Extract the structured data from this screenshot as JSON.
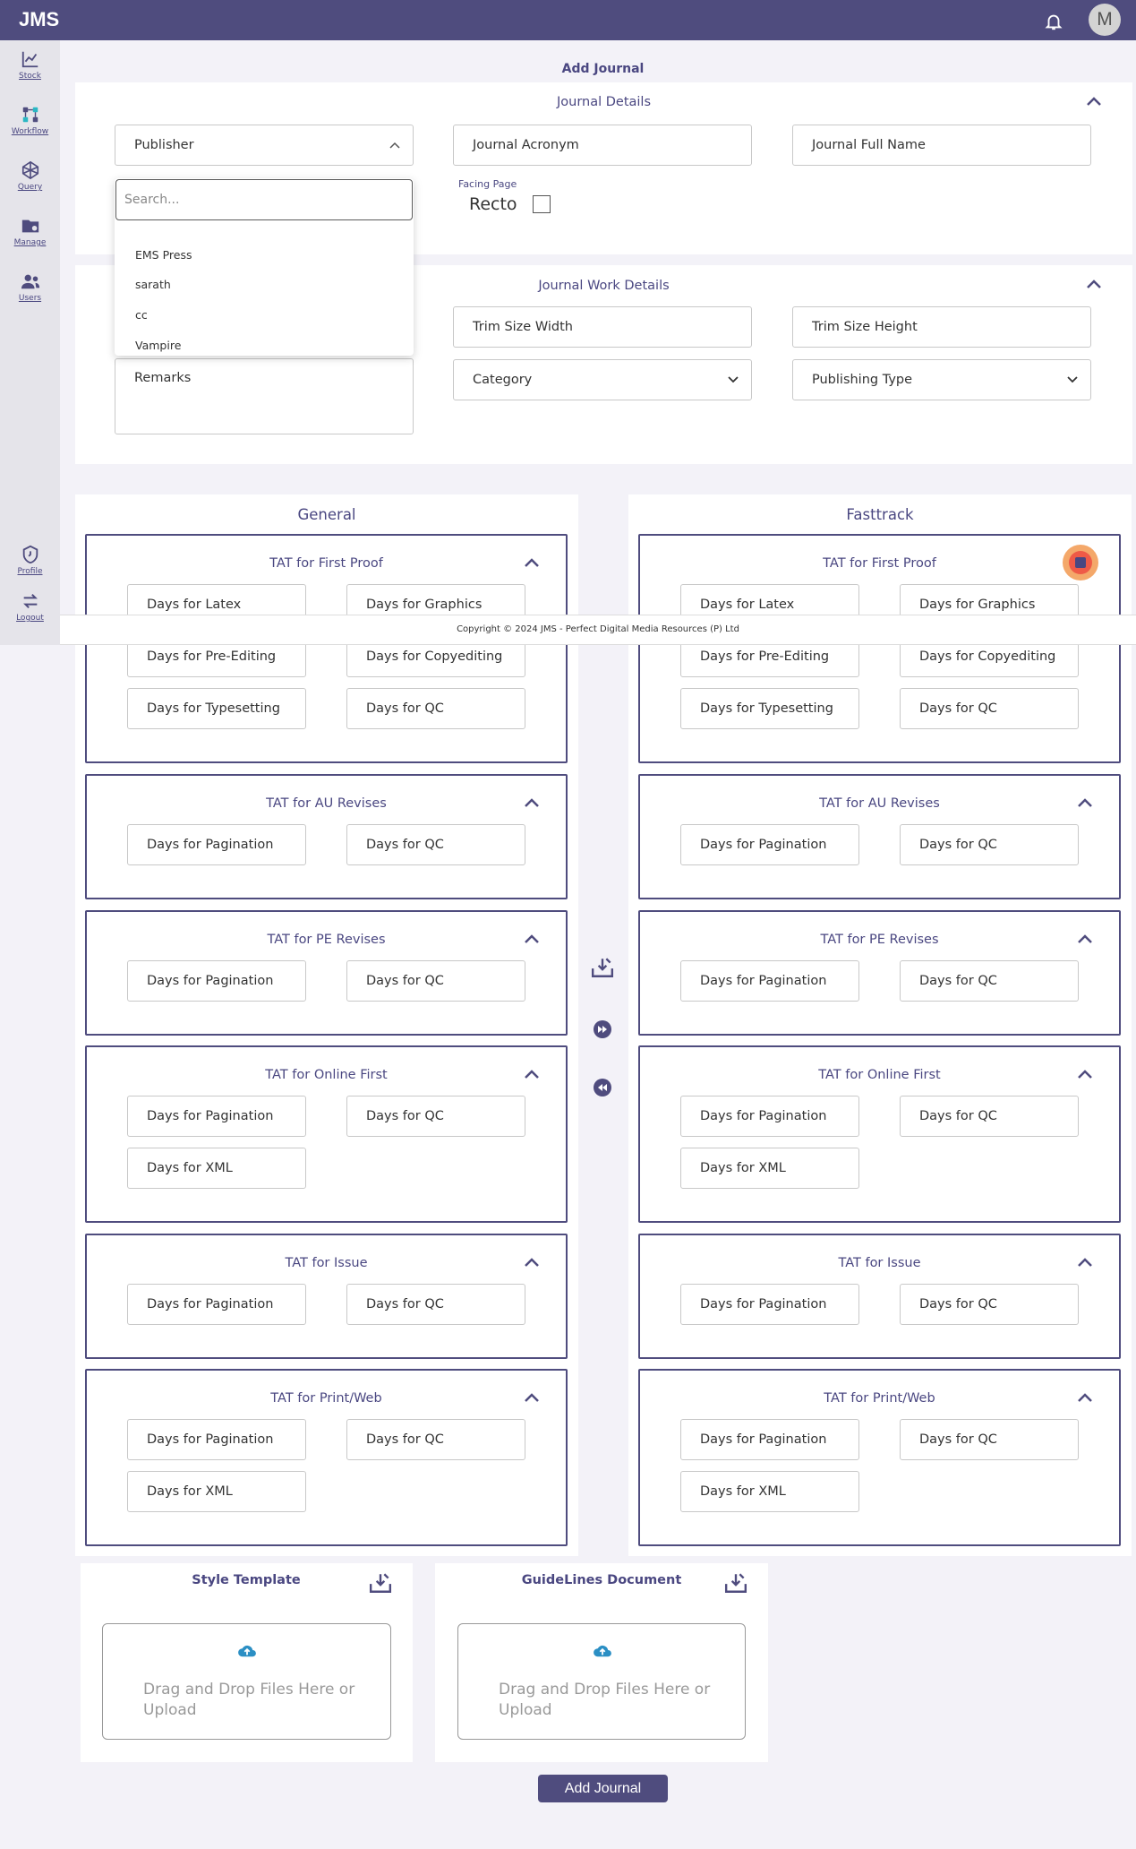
{
  "app": {
    "logo": "JMS",
    "avatar_letter": "M"
  },
  "sidebar": {
    "items": [
      {
        "label": "Stock",
        "icon": "chart-line-icon"
      },
      {
        "label": "Workflow",
        "icon": "workflow-icon"
      },
      {
        "label": "Query",
        "icon": "query-icon"
      },
      {
        "label": "Manage",
        "icon": "folder-gear-icon"
      },
      {
        "label": "Users",
        "icon": "users-icon"
      },
      {
        "label": "Profile",
        "icon": "shield-icon"
      },
      {
        "label": "Logout",
        "icon": "logout-icon"
      }
    ]
  },
  "page": {
    "title": "Add Journal"
  },
  "journal_details": {
    "title": "Journal Details",
    "publisher_label": "Publisher",
    "search_placeholder": "Search...",
    "options": [
      "EMS Press",
      "sarath",
      "cc",
      "Vampire"
    ],
    "acronym_placeholder": "Journal Acronym",
    "fullname_placeholder": "Journal Full Name",
    "facing_page_label": "Facing Page",
    "facing_page_value": "Recto"
  },
  "work_details": {
    "title": "Journal Work Details",
    "trim_width": "Trim Size Width",
    "trim_height": "Trim Size Height",
    "remarks": "Remarks",
    "category": "Category",
    "publishing_type": "Publishing Type"
  },
  "general": {
    "title": "General"
  },
  "fasttrack": {
    "title": "Fasttrack"
  },
  "tat": {
    "first_proof": {
      "title": "TAT for First Proof",
      "fields": [
        "Days for Latex",
        "Days for Graphics",
        "Days for Pre-Editing",
        "Days for Copyediting",
        "Days for Typesetting",
        "Days for QC"
      ]
    },
    "au_revises": {
      "title": "TAT for AU Revises",
      "fields": [
        "Days for Pagination",
        "Days for QC"
      ]
    },
    "pe_revises": {
      "title": "TAT for PE Revises",
      "fields": [
        "Days for Pagination",
        "Days for QC"
      ]
    },
    "online_first": {
      "title": "TAT for Online First",
      "fields": [
        "Days for Pagination",
        "Days for QC",
        "Days for XML"
      ]
    },
    "issue": {
      "title": "TAT for Issue",
      "fields": [
        "Days for Pagination",
        "Days for QC"
      ]
    },
    "print_web": {
      "title": "TAT for Print/Web",
      "fields": [
        "Days for Pagination",
        "Days for QC",
        "Days for XML"
      ]
    }
  },
  "footer": {
    "copyright": "Copyright © 2024 JMS - Perfect Digital Media Resources (P) Ltd"
  },
  "uploads": {
    "style_template": "Style Template",
    "guidelines": "GuideLines Document",
    "drop_text": "Drag and Drop Files Here or Upload"
  },
  "actions": {
    "add_journal": "Add Journal"
  },
  "colors": {
    "primary": "#4f4c7e",
    "sidebar_bg": "#e5e4ea",
    "page_bg": "#f3f2f8"
  }
}
